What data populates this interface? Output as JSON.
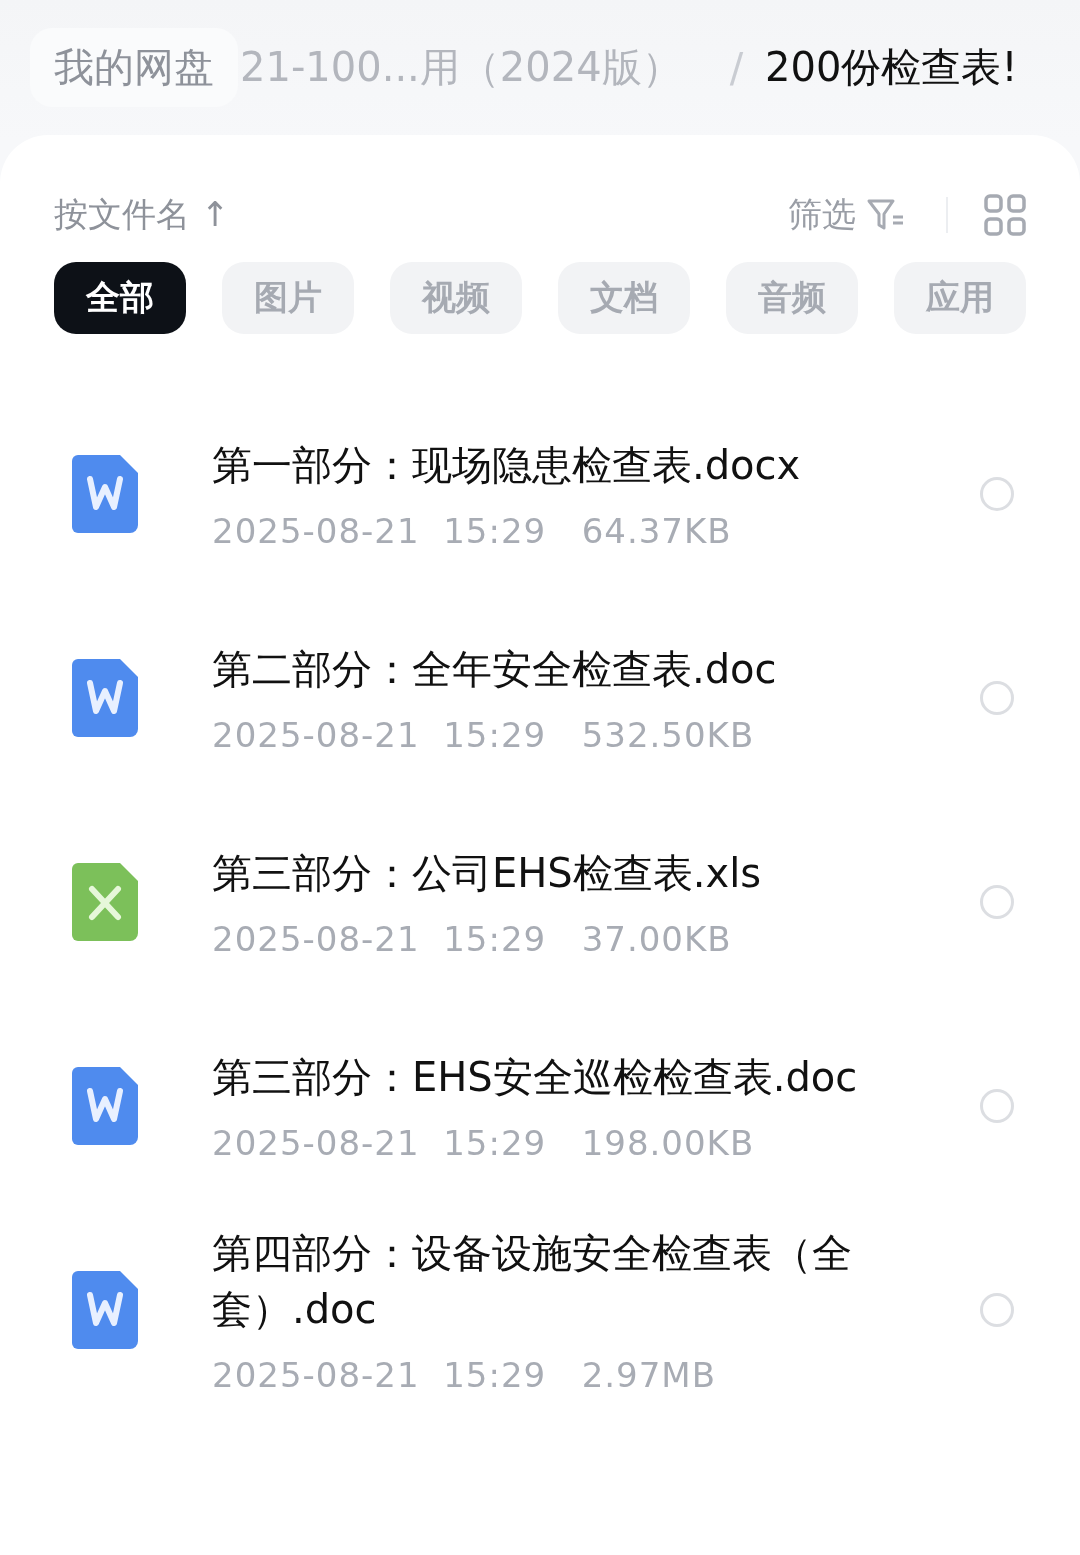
{
  "breadcrumb": {
    "root": "我的网盘",
    "middle": "21-100...用（2024版）",
    "separator": "/",
    "current": "200份检查表!"
  },
  "toolbar": {
    "sort": "按文件名 ↑",
    "filter": "筛选"
  },
  "tabs": [
    {
      "label": "全部",
      "selected": true
    },
    {
      "label": "图片",
      "selected": false
    },
    {
      "label": "视频",
      "selected": false
    },
    {
      "label": "文档",
      "selected": false
    },
    {
      "label": "音频",
      "selected": false
    },
    {
      "label": "应用",
      "selected": false
    }
  ],
  "files": [
    {
      "kind": "word",
      "name": "第一部分：现场隐患检查表.docx",
      "date": "2025-08-21",
      "time": "15:29",
      "size": "64.37KB",
      "checked": false
    },
    {
      "kind": "word",
      "name": "第二部分：全年安全检查表.doc",
      "date": "2025-08-21",
      "time": "15:29",
      "size": "532.50KB",
      "checked": false
    },
    {
      "kind": "excel",
      "name": "第三部分：公司EHS检查表.xls",
      "date": "2025-08-21",
      "time": "15:29",
      "size": "37.00KB",
      "checked": false
    },
    {
      "kind": "word",
      "name": "第三部分：EHS安全巡检检查表.doc",
      "date": "2025-08-21",
      "time": "15:29",
      "size": "198.00KB",
      "checked": false
    },
    {
      "kind": "word",
      "name": "第四部分：设备设施安全检查表（全套）.doc",
      "date": "2025-08-21",
      "time": "15:29",
      "size": "2.97MB",
      "checked": false
    }
  ]
}
